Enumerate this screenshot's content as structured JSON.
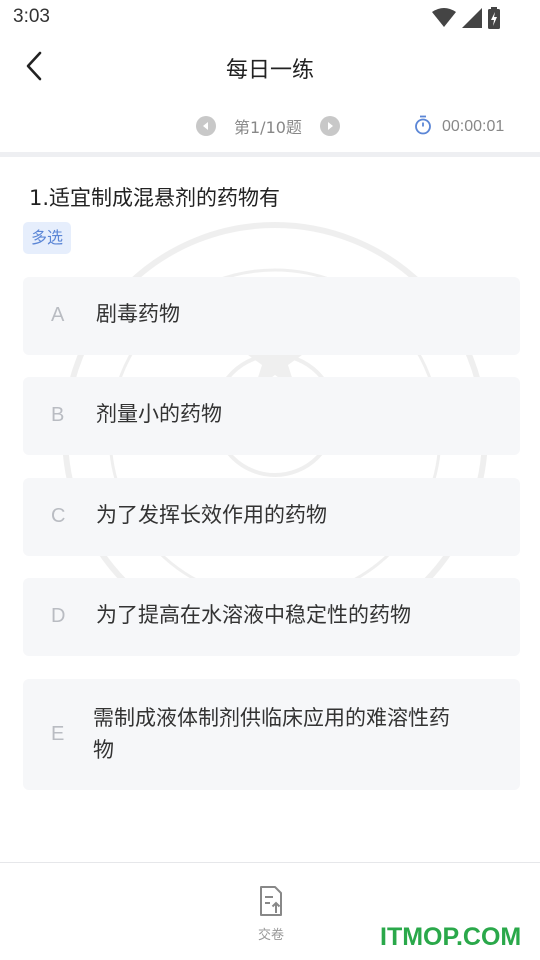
{
  "status_bar": {
    "time": "3:03"
  },
  "nav": {
    "title": "每日一练"
  },
  "pager": {
    "label": "第1/10题"
  },
  "timer": {
    "value": "00:00:01"
  },
  "question": {
    "text": "1.适宜制成混悬剂的药物有",
    "type": "多选"
  },
  "options": [
    {
      "letter": "A",
      "text": "剧毒药物"
    },
    {
      "letter": "B",
      "text": "剂量小的药物"
    },
    {
      "letter": "C",
      "text": "为了发挥长效作用的药物"
    },
    {
      "letter": "D",
      "text": "为了提高在水溶液中稳定性的药物"
    },
    {
      "letter": "E",
      "text": "需制成液体制剂供临床应用的难溶性药物"
    }
  ],
  "bottom": {
    "submit_label": "交卷",
    "brand": "ITMOP.COM"
  },
  "colors": {
    "badge_bg": "#e6eefc",
    "badge_text": "#5b86d6",
    "brand": "#2aa84a",
    "timer_icon": "#5b86d6"
  }
}
